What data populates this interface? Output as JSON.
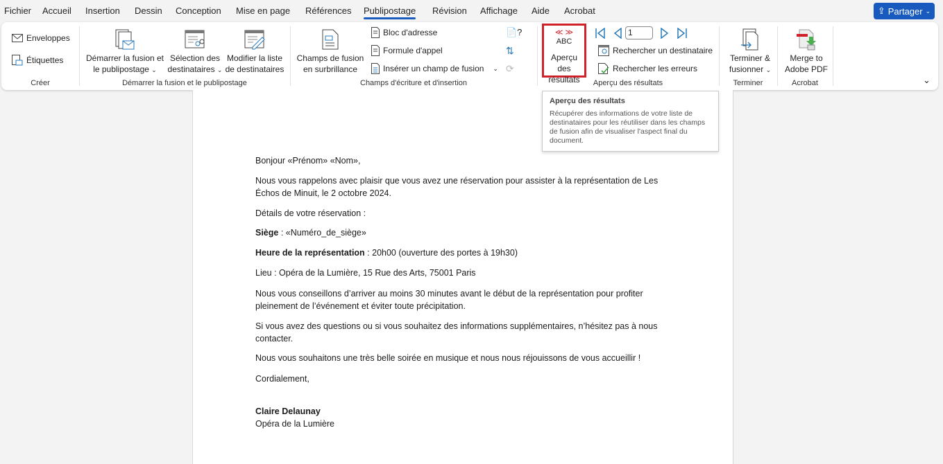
{
  "menu": {
    "tabs": [
      "Fichier",
      "Accueil",
      "Insertion",
      "Dessin",
      "Conception",
      "Mise en page",
      "Références",
      "Publipostage",
      "Révision",
      "Affichage",
      "Aide",
      "Acrobat"
    ],
    "active": "Publipostage",
    "share_label": "Partager"
  },
  "ribbon": {
    "creer": {
      "label": "Créer",
      "enveloppes": "Enveloppes",
      "etiquettes": "Étiquettes"
    },
    "demarrer": {
      "label": "Démarrer la fusion et le publipostage",
      "start_l1": "Démarrer la fusion et",
      "start_l2": "le publipostage",
      "select_l1": "Sélection des",
      "select_l2": "destinataires",
      "edit_l1": "Modifier la liste",
      "edit_l2": "de destinataires"
    },
    "champs": {
      "label": "Champs d'écriture et d'insertion",
      "highlight_l1": "Champs de fusion",
      "highlight_l2": "en surbrillance",
      "bloc": "Bloc d'adresse",
      "formule": "Formule d'appel",
      "inserer": "Insérer un champ de fusion"
    },
    "apercu": {
      "label": "Aperçu des résultats",
      "preview_l1": "Aperçu des",
      "preview_l2": "résultats",
      "abc": "ABC",
      "record": "1",
      "find": "Rechercher un destinataire",
      "errors": "Rechercher les erreurs"
    },
    "terminer": {
      "label": "Terminer",
      "finish_l1": "Terminer &",
      "finish_l2": "fusionner"
    },
    "acrobat": {
      "label": "Acrobat",
      "merge_l1": "Merge to",
      "merge_l2": "Adobe PDF"
    }
  },
  "tooltip": {
    "title": "Aperçu des résultats",
    "desc": "Récupérer des informations de votre liste de destinataires pour les réutiliser dans les champs de fusion afin de visualiser l'aspect final du document."
  },
  "document": {
    "greeting": "Bonjour «Prénom» «Nom»,",
    "p1": "Nous vous rappelons avec plaisir que vous avez une réservation pour assister à la représentation de Les Échos de Minuit, le 2 octobre 2024.",
    "p2": "Détails de votre réservation :",
    "seat_label": "Siège",
    "seat_value": " : «Numéro_de_siège»",
    "time_label": "Heure de la représentation",
    "time_value": " : 20h00 (ouverture des portes à 19h30)",
    "place": "Lieu : Opéra de la Lumière, 15 Rue des Arts, 75001 Paris",
    "p3": "Nous vous conseillons d’arriver au moins 30 minutes avant le début de la représentation pour profiter pleinement de l’événement et éviter toute précipitation.",
    "p4": "Si vous avez des questions ou si vous souhaitez des informations supplémentaires, n’hésitez pas à nous contacter.",
    "p5": "Nous vous souhaitons une très belle soirée en musique et nous nous réjouissons de vous accueillir !",
    "closing": "Cordialement,",
    "signer": "Claire Delaunay",
    "org": "Opéra de la Lumière"
  },
  "colors": {
    "accent": "#185abd",
    "highlight_border": "#d0202a"
  }
}
